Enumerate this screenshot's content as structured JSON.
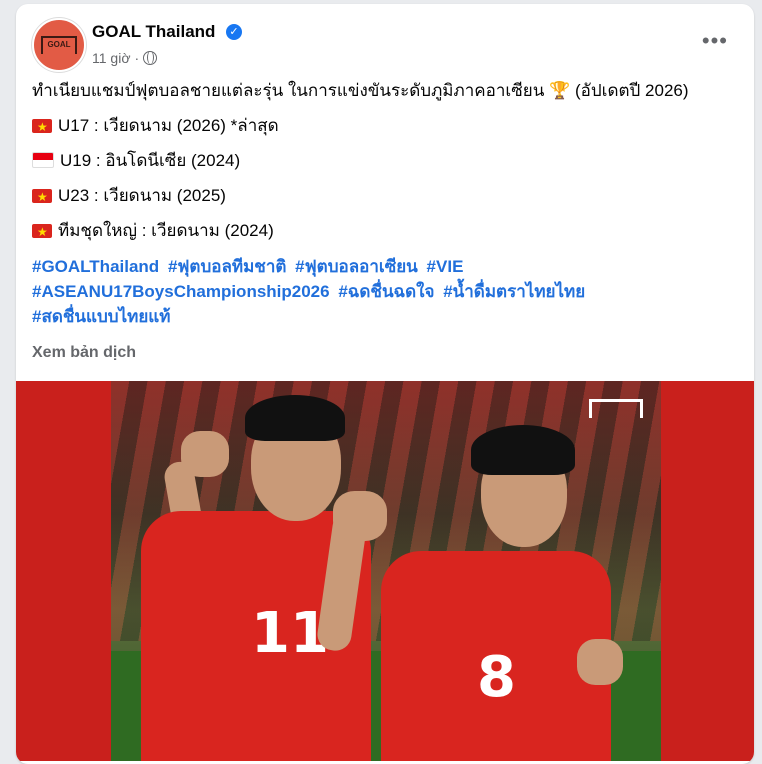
{
  "post": {
    "page_name": "GOAL Thailand",
    "verified_icon": "verified-badge-icon",
    "time": "11 giờ",
    "separator": "·",
    "privacy_icon": "globe-icon",
    "more_label": "•••",
    "avatar_text": "GOAL",
    "headline": "ทำเนียบแชมป์ฟุตบอลชายแต่ละรุ่น ในการแข่งขันระดับภูมิภาคอาเซียน",
    "headline_suffix": "(อัปเดตปี 2026)",
    "lines": [
      {
        "flag": "vietnam-flag-icon",
        "text": "U17 : เวียดนาม (2026) *ล่าสุด"
      },
      {
        "flag": "indonesia-flag-icon",
        "text": "U19 : อินโดนีเซีย (2024)"
      },
      {
        "flag": "vietnam-flag-icon",
        "text": "U23 : เวียดนาม (2025)"
      },
      {
        "flag": "vietnam-flag-icon",
        "text": "ทีมชุดใหญ่ : เวียดนาม (2024)"
      }
    ],
    "hashtags": [
      "#GOALThailand",
      "#ฟุตบอลทีมชาติ",
      "#ฟุตบอลอาเซียน",
      "#VIE",
      "#ASEANU17BoysChampionship2026",
      "#ฉดชื่นฉดใจ",
      "#น้ำดื่มตราไทยไทย",
      "#สดชื่นแบบไทยแท้"
    ],
    "translate_label": "Xem bản dịch",
    "photo": {
      "left_player_number": "11",
      "right_player_number": "8"
    }
  },
  "colors": {
    "link": "#216fdb",
    "photo_border": "#c9201c",
    "jersey": "#d9251f"
  }
}
